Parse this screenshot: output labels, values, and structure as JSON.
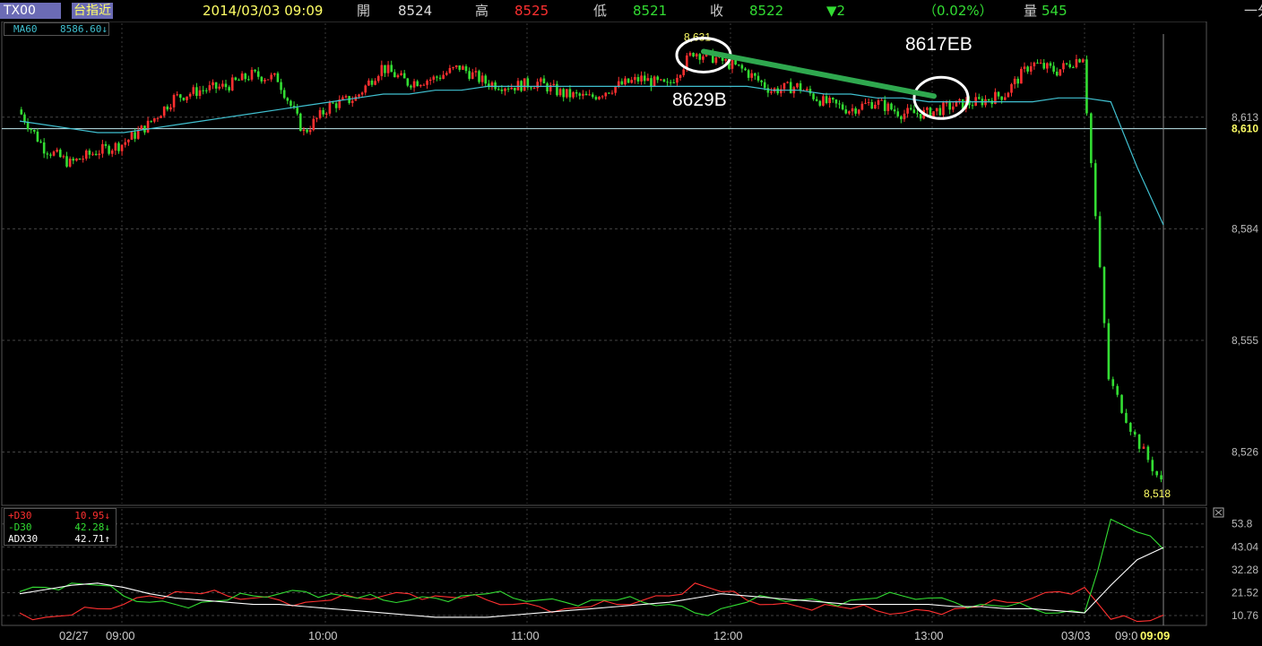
{
  "header": {
    "symbol": "TX00",
    "index_label": "台指近",
    "datetime": "2014/03/03 09:09",
    "open_label": "開",
    "open": "8524",
    "high_label": "高",
    "high": "8525",
    "low_label": "低",
    "low": "8521",
    "close_label": "收",
    "close": "8522",
    "change": "▼2",
    "change_pct": "（0.02%）",
    "volume_label": "量",
    "volume": "545",
    "corner": "一分"
  },
  "ma_legend": {
    "label": "MA60",
    "value": "8586.60↓"
  },
  "dmi_legend": [
    {
      "label": "+D30",
      "value": "10.95↓",
      "color": "#ff3030"
    },
    {
      "label": "-D30",
      "value": "42.28↓",
      "color": "#33dd33"
    },
    {
      "label": "ADX30",
      "value": "42.71↑",
      "color": "#ffffff"
    }
  ],
  "annotations": {
    "high_value": "8,631",
    "low_value": "8,518",
    "entry_label": "8629B",
    "exit_label": "8617EB"
  },
  "colors": {
    "up": "#ff3030",
    "down": "#33dd33",
    "ma": "#40c0d0",
    "trend": "#2fa84f",
    "label_yellow": "#ffff66"
  },
  "chart_data": [
    {
      "type": "candlestick",
      "title": "",
      "x_tick_labels": [
        "02/27",
        "09:00",
        "10:00",
        "11:00",
        "12:00",
        "13:00",
        "03/03",
        "09:0",
        "09:09"
      ],
      "y_tick_labels": [
        "8,613",
        "8,610",
        "8,584",
        "8,555",
        "8,526"
      ],
      "ylim": [
        8514,
        8636
      ],
      "series": [
        {
          "name": "MA60",
          "values": [
            8612,
            8611,
            8610,
            8609,
            8609,
            8610,
            8611,
            8612,
            8613,
            8614,
            8615,
            8616,
            8617,
            8618,
            8619,
            8619,
            8620,
            8620,
            8621,
            8621,
            8621,
            8621,
            8621,
            8621,
            8621,
            8621,
            8621,
            8621,
            8621,
            8620,
            8620,
            8619,
            8619,
            8618,
            8618,
            8617,
            8617,
            8617,
            8617,
            8617,
            8618,
            8618,
            8617,
            8600,
            8585
          ]
        },
        {
          "name": "close",
          "values": [
            8615,
            8605,
            8601,
            8604,
            8606,
            8611,
            8618,
            8620,
            8621,
            8624,
            8623,
            8609,
            8616,
            8618,
            8626,
            8622,
            8623,
            8626,
            8622,
            8621,
            8622,
            8619,
            8618,
            8621,
            8623,
            8621,
            8630,
            8628,
            8625,
            8620,
            8621,
            8617,
            8615,
            8617,
            8614,
            8614,
            8616,
            8617,
            8619,
            8627,
            8625,
            8629,
            8545,
            8530,
            8518
          ]
        }
      ]
    },
    {
      "type": "line",
      "title": "",
      "y_tick_labels": [
        "53.8",
        "43.04",
        "32.28",
        "21.52",
        "10.76"
      ],
      "ylim": [
        7,
        60
      ],
      "series": [
        {
          "name": "+D30",
          "values": [
            12,
            10,
            11,
            14,
            16,
            20,
            22,
            21,
            20,
            19,
            18,
            17,
            18,
            19,
            20,
            21,
            20,
            19,
            18,
            16,
            15,
            14,
            15,
            16,
            18,
            20,
            26,
            22,
            18,
            16,
            15,
            16,
            14,
            13,
            12,
            13,
            14,
            15,
            17,
            19,
            22,
            24,
            9,
            8,
            11
          ]
        },
        {
          "name": "-D30",
          "values": [
            22,
            24,
            26,
            25,
            20,
            17,
            16,
            17,
            18,
            20,
            21,
            22,
            21,
            19,
            18,
            18,
            19,
            20,
            21,
            19,
            18,
            17,
            18,
            18,
            17,
            16,
            12,
            14,
            17,
            19,
            18,
            17,
            18,
            19,
            20,
            19,
            17,
            16,
            15,
            14,
            12,
            12,
            56,
            50,
            42
          ]
        },
        {
          "name": "ADX30",
          "values": [
            21,
            23,
            25,
            26,
            24,
            21,
            19,
            18,
            17,
            16,
            16,
            15,
            14,
            13,
            12,
            11,
            10,
            10,
            10,
            11,
            12,
            13,
            14,
            15,
            16,
            17,
            19,
            21,
            20,
            19,
            18,
            17,
            16,
            16,
            16,
            16,
            15,
            15,
            14,
            14,
            13,
            12,
            25,
            37,
            42.7
          ]
        }
      ]
    }
  ]
}
